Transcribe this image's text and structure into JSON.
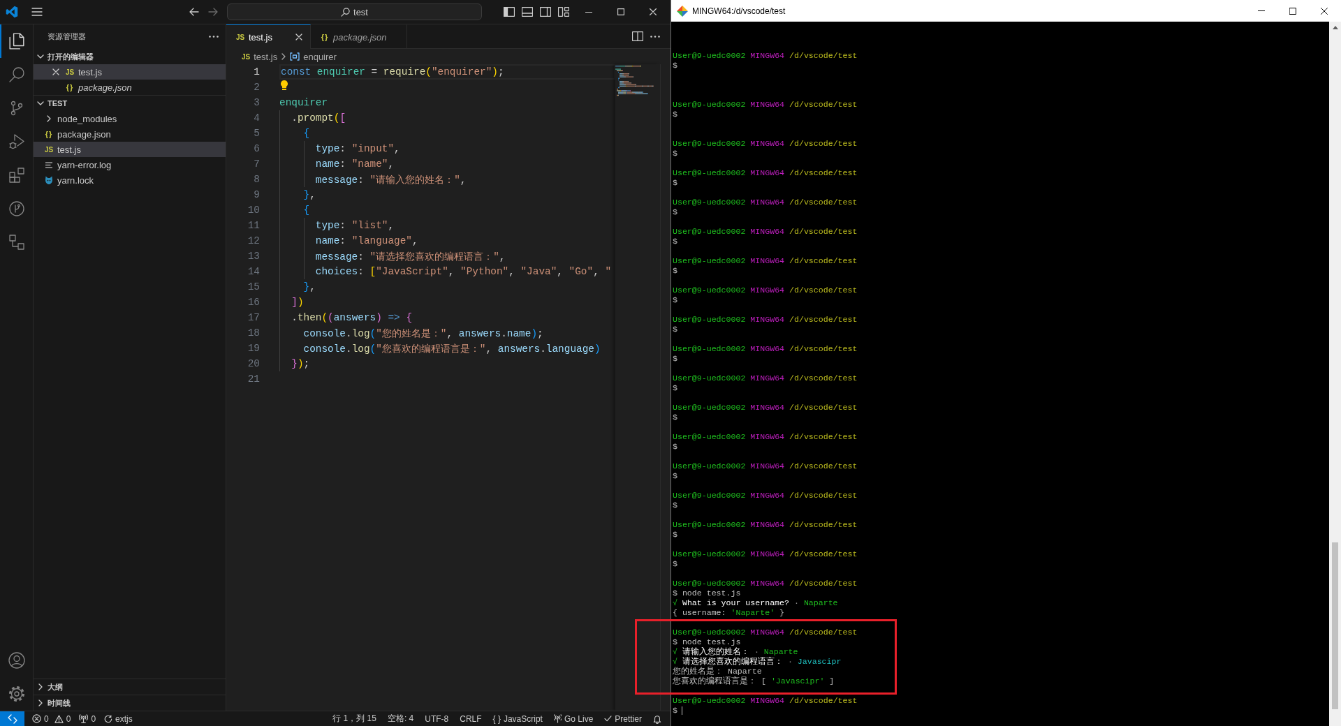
{
  "vscode": {
    "title_bar": {
      "search_text": "test"
    },
    "activity_bar": {
      "top": [
        {
          "kind": "explorer",
          "selected": true
        },
        {
          "kind": "search",
          "selected": false
        },
        {
          "kind": "scm",
          "selected": false
        },
        {
          "kind": "debug",
          "selected": false
        },
        {
          "kind": "extensions",
          "selected": false
        },
        {
          "kind": "graph",
          "selected": false
        },
        {
          "kind": "remote",
          "selected": false
        }
      ],
      "bottom": [
        {
          "kind": "account"
        },
        {
          "kind": "settings"
        }
      ]
    },
    "sidebar": {
      "title": "资源管理器",
      "sections": [
        {
          "kind": "editors",
          "title": "打开的编辑器",
          "expanded": true,
          "items": [
            {
              "kind": "js",
              "glyph": "JS",
              "label": "test.js",
              "selected": true,
              "preview": false
            },
            {
              "kind": "json",
              "glyph": "{}",
              "label": "package.json",
              "selected": false,
              "preview": true
            }
          ]
        },
        {
          "kind": "tree",
          "title": "TEST",
          "expanded": true,
          "items": [
            {
              "kind": "folder",
              "label": "node_modules",
              "expanded": false,
              "selected": false
            },
            {
              "kind": "json",
              "glyph": "{}",
              "label": "package.json",
              "selected": false
            },
            {
              "kind": "js",
              "glyph": "JS",
              "label": "test.js",
              "selected": true
            },
            {
              "kind": "log",
              "label": "yarn-error.log",
              "selected": false
            },
            {
              "kind": "yarn",
              "label": "yarn.lock",
              "selected": false
            }
          ]
        },
        {
          "kind": "pane",
          "title": "大纲",
          "expanded": false
        },
        {
          "kind": "pane",
          "title": "时间线",
          "expanded": false
        }
      ]
    },
    "editor": {
      "tabs": [
        {
          "kind": "js",
          "glyph": "JS",
          "label": "test.js",
          "selected": true,
          "preview": false
        },
        {
          "kind": "json",
          "glyph": "{}",
          "label": "package.json",
          "selected": false,
          "preview": true
        }
      ],
      "breadcrumb": [
        {
          "kind": "file",
          "glyph": "JS",
          "label": "test.js"
        },
        {
          "kind": "symbol",
          "label": "enquirer"
        }
      ],
      "lines": [
        {
          "number": "1",
          "kind": "code",
          "current": true,
          "tokens": [
            {
              "kind": "keyword",
              "text": "const "
            },
            {
              "kind": "module",
              "text": "enquirer"
            },
            {
              "kind": "plain",
              "text": " = "
            },
            {
              "kind": "function",
              "text": "require"
            },
            {
              "kind": "bracket1",
              "text": "("
            },
            {
              "kind": "string",
              "text": "\"enquirer\""
            },
            {
              "kind": "bracket1",
              "text": ")"
            },
            {
              "kind": "plain",
              "text": ";"
            }
          ]
        },
        {
          "number": "2",
          "kind": "lightbulb",
          "current": false
        },
        {
          "number": "3",
          "kind": "code",
          "current": false,
          "tokens": [
            {
              "kind": "module",
              "text": "enquirer"
            }
          ],
          "children": [
            {
              "number": "4",
              "kind": "code",
              "current": false,
              "tokens": [
                {
                  "kind": "plain",
                  "text": "."
                },
                {
                  "kind": "function",
                  "text": "prompt"
                },
                {
                  "kind": "bracket1",
                  "text": "("
                },
                {
                  "kind": "bracket2",
                  "text": "["
                }
              ],
              "children": [
                {
                  "number": "5",
                  "kind": "code",
                  "current": false,
                  "tokens": [
                    {
                      "kind": "bracket3",
                      "text": "{"
                    }
                  ],
                  "children": [
                    {
                      "number": "6",
                      "kind": "code",
                      "current": false,
                      "tokens": [
                        {
                          "kind": "property",
                          "text": "type"
                        },
                        {
                          "kind": "plain",
                          "text": ": "
                        },
                        {
                          "kind": "string",
                          "text": "\"input\""
                        },
                        {
                          "kind": "plain",
                          "text": ","
                        }
                      ]
                    },
                    {
                      "number": "7",
                      "kind": "code",
                      "current": false,
                      "tokens": [
                        {
                          "kind": "property",
                          "text": "name"
                        },
                        {
                          "kind": "plain",
                          "text": ": "
                        },
                        {
                          "kind": "string",
                          "text": "\"name\""
                        },
                        {
                          "kind": "plain",
                          "text": ","
                        }
                      ]
                    },
                    {
                      "number": "8",
                      "kind": "code",
                      "current": false,
                      "tokens": [
                        {
                          "kind": "property",
                          "text": "message"
                        },
                        {
                          "kind": "plain",
                          "text": ": "
                        },
                        {
                          "kind": "string",
                          "text": "\"请输入您的姓名：\""
                        },
                        {
                          "kind": "plain",
                          "text": ","
                        }
                      ]
                    }
                  ]
                },
                {
                  "number": "9",
                  "kind": "code",
                  "current": false,
                  "tokens": [
                    {
                      "kind": "bracket3",
                      "text": "}"
                    },
                    {
                      "kind": "plain",
                      "text": ","
                    }
                  ]
                },
                {
                  "number": "10",
                  "kind": "code",
                  "current": false,
                  "tokens": [
                    {
                      "kind": "bracket3",
                      "text": "{"
                    }
                  ],
                  "children": [
                    {
                      "number": "11",
                      "kind": "code",
                      "current": false,
                      "tokens": [
                        {
                          "kind": "property",
                          "text": "type"
                        },
                        {
                          "kind": "plain",
                          "text": ": "
                        },
                        {
                          "kind": "string",
                          "text": "\"list\""
                        },
                        {
                          "kind": "plain",
                          "text": ","
                        }
                      ]
                    },
                    {
                      "number": "12",
                      "kind": "code",
                      "current": false,
                      "tokens": [
                        {
                          "kind": "property",
                          "text": "name"
                        },
                        {
                          "kind": "plain",
                          "text": ": "
                        },
                        {
                          "kind": "string",
                          "text": "\"language\""
                        },
                        {
                          "kind": "plain",
                          "text": ","
                        }
                      ]
                    },
                    {
                      "number": "13",
                      "kind": "code",
                      "current": false,
                      "tokens": [
                        {
                          "kind": "property",
                          "text": "message"
                        },
                        {
                          "kind": "plain",
                          "text": ": "
                        },
                        {
                          "kind": "string",
                          "text": "\"请选择您喜欢的编程语言：\""
                        },
                        {
                          "kind": "plain",
                          "text": ","
                        }
                      ]
                    },
                    {
                      "number": "14",
                      "kind": "code",
                      "current": false,
                      "tokens": [
                        {
                          "kind": "property",
                          "text": "choices"
                        },
                        {
                          "kind": "plain",
                          "text": ": "
                        },
                        {
                          "kind": "bracket1",
                          "text": "["
                        },
                        {
                          "kind": "string",
                          "text": "\"JavaScript\""
                        },
                        {
                          "kind": "plain",
                          "text": ", "
                        },
                        {
                          "kind": "string",
                          "text": "\"Python\""
                        },
                        {
                          "kind": "plain",
                          "text": ", "
                        },
                        {
                          "kind": "string",
                          "text": "\"Java\""
                        },
                        {
                          "kind": "plain",
                          "text": ", "
                        },
                        {
                          "kind": "string",
                          "text": "\"Go\""
                        },
                        {
                          "kind": "plain",
                          "text": ", "
                        },
                        {
                          "kind": "string",
                          "text": "\""
                        }
                      ]
                    }
                  ]
                },
                {
                  "number": "15",
                  "kind": "code",
                  "current": false,
                  "tokens": [
                    {
                      "kind": "bracket3",
                      "text": "}"
                    },
                    {
                      "kind": "plain",
                      "text": ","
                    }
                  ]
                }
              ]
            },
            {
              "number": "16",
              "kind": "code",
              "current": false,
              "tokens": [
                {
                  "kind": "bracket2",
                  "text": "]"
                },
                {
                  "kind": "bracket1",
                  "text": ")"
                }
              ]
            },
            {
              "number": "17",
              "kind": "code",
              "current": false,
              "tokens": [
                {
                  "kind": "plain",
                  "text": "."
                },
                {
                  "kind": "function",
                  "text": "then"
                },
                {
                  "kind": "bracket1",
                  "text": "("
                },
                {
                  "kind": "bracket2",
                  "text": "("
                },
                {
                  "kind": "parameter",
                  "text": "answers"
                },
                {
                  "kind": "bracket2",
                  "text": ")"
                },
                {
                  "kind": "keyword",
                  "text": " => "
                },
                {
                  "kind": "bracket2",
                  "text": "{"
                }
              ],
              "children": [
                {
                  "number": "18",
                  "kind": "code",
                  "current": false,
                  "tokens": [
                    {
                      "kind": "variable",
                      "text": "console"
                    },
                    {
                      "kind": "plain",
                      "text": "."
                    },
                    {
                      "kind": "function",
                      "text": "log"
                    },
                    {
                      "kind": "bracket3",
                      "text": "("
                    },
                    {
                      "kind": "string",
                      "text": "\"您的姓名是：\""
                    },
                    {
                      "kind": "plain",
                      "text": ", "
                    },
                    {
                      "kind": "variable",
                      "text": "answers"
                    },
                    {
                      "kind": "plain",
                      "text": "."
                    },
                    {
                      "kind": "variable",
                      "text": "name"
                    },
                    {
                      "kind": "bracket3",
                      "text": ")"
                    },
                    {
                      "kind": "plain",
                      "text": ";"
                    }
                  ]
                },
                {
                  "number": "19",
                  "kind": "code",
                  "current": false,
                  "tokens": [
                    {
                      "kind": "variable",
                      "text": "console"
                    },
                    {
                      "kind": "plain",
                      "text": "."
                    },
                    {
                      "kind": "function",
                      "text": "log"
                    },
                    {
                      "kind": "bracket3",
                      "text": "("
                    },
                    {
                      "kind": "string",
                      "text": "\"您喜欢的编程语言是：\""
                    },
                    {
                      "kind": "plain",
                      "text": ", "
                    },
                    {
                      "kind": "variable",
                      "text": "answers"
                    },
                    {
                      "kind": "plain",
                      "text": "."
                    },
                    {
                      "kind": "variable",
                      "text": "language"
                    },
                    {
                      "kind": "bracket3",
                      "text": ")"
                    }
                  ]
                }
              ]
            },
            {
              "number": "20",
              "kind": "code",
              "current": false,
              "tokens": [
                {
                  "kind": "bracket2",
                  "text": "}"
                },
                {
                  "kind": "bracket1",
                  "text": ")"
                },
                {
                  "kind": "plain",
                  "text": ";"
                }
              ]
            }
          ]
        },
        {
          "number": "21",
          "kind": "code",
          "current": false
        }
      ]
    },
    "status_bar": {
      "left": [
        {
          "kind": "remote"
        },
        {
          "kind": "problems",
          "errors": "0",
          "warnings": "0"
        },
        {
          "kind": "ports",
          "label": "0"
        },
        {
          "kind": "sync",
          "label": "extjs"
        }
      ],
      "right": [
        {
          "kind": "text",
          "label": "行 1，列 15"
        },
        {
          "kind": "text",
          "label": "空格: 4"
        },
        {
          "kind": "text",
          "label": "UTF-8"
        },
        {
          "kind": "text",
          "label": "CRLF"
        },
        {
          "kind": "language",
          "glyph": "{ }",
          "label": "JavaScript"
        },
        {
          "kind": "golive",
          "label": "Go Live"
        },
        {
          "kind": "prettier",
          "label": "Prettier"
        },
        {
          "kind": "bell"
        }
      ]
    }
  },
  "terminal": {
    "title": "MINGW64:/d/vscode/test",
    "lines": [
      {
        "kind": "blank"
      },
      {
        "kind": "blank"
      },
      {
        "kind": "blank"
      },
      {
        "kind": "prompt",
        "user": "User@9-uedc0002",
        "shell": "MINGW64",
        "path": "/d/vscode/test"
      },
      {
        "kind": "plain",
        "text": "$"
      },
      {
        "kind": "blank"
      },
      {
        "kind": "blank"
      },
      {
        "kind": "blank"
      },
      {
        "kind": "prompt",
        "user": "User@9-uedc0002",
        "shell": "MINGW64",
        "path": "/d/vscode/test"
      },
      {
        "kind": "plain",
        "text": "$"
      },
      {
        "kind": "blank"
      },
      {
        "kind": "blank"
      },
      {
        "kind": "prompt",
        "user": "User@9-uedc0002",
        "shell": "MINGW64",
        "path": "/d/vscode/test"
      },
      {
        "kind": "plain",
        "text": "$"
      },
      {
        "kind": "blank"
      },
      {
        "kind": "prompt",
        "user": "User@9-uedc0002",
        "shell": "MINGW64",
        "path": "/d/vscode/test"
      },
      {
        "kind": "plain",
        "text": "$"
      },
      {
        "kind": "blank"
      },
      {
        "kind": "prompt",
        "user": "User@9-uedc0002",
        "shell": "MINGW64",
        "path": "/d/vscode/test"
      },
      {
        "kind": "plain",
        "text": "$"
      },
      {
        "kind": "blank"
      },
      {
        "kind": "prompt",
        "user": "User@9-uedc0002",
        "shell": "MINGW64",
        "path": "/d/vscode/test"
      },
      {
        "kind": "plain",
        "text": "$"
      },
      {
        "kind": "blank"
      },
      {
        "kind": "prompt",
        "user": "User@9-uedc0002",
        "shell": "MINGW64",
        "path": "/d/vscode/test"
      },
      {
        "kind": "plain",
        "text": "$"
      },
      {
        "kind": "blank"
      },
      {
        "kind": "prompt",
        "user": "User@9-uedc0002",
        "shell": "MINGW64",
        "path": "/d/vscode/test"
      },
      {
        "kind": "plain",
        "text": "$"
      },
      {
        "kind": "blank"
      },
      {
        "kind": "prompt",
        "user": "User@9-uedc0002",
        "shell": "MINGW64",
        "path": "/d/vscode/test"
      },
      {
        "kind": "plain",
        "text": "$"
      },
      {
        "kind": "blank"
      },
      {
        "kind": "prompt",
        "user": "User@9-uedc0002",
        "shell": "MINGW64",
        "path": "/d/vscode/test"
      },
      {
        "kind": "plain",
        "text": "$"
      },
      {
        "kind": "blank"
      },
      {
        "kind": "prompt",
        "user": "User@9-uedc0002",
        "shell": "MINGW64",
        "path": "/d/vscode/test"
      },
      {
        "kind": "plain",
        "text": "$"
      },
      {
        "kind": "blank"
      },
      {
        "kind": "prompt",
        "user": "User@9-uedc0002",
        "shell": "MINGW64",
        "path": "/d/vscode/test"
      },
      {
        "kind": "plain",
        "text": "$"
      },
      {
        "kind": "blank"
      },
      {
        "kind": "prompt",
        "user": "User@9-uedc0002",
        "shell": "MINGW64",
        "path": "/d/vscode/test"
      },
      {
        "kind": "plain",
        "text": "$"
      },
      {
        "kind": "blank"
      },
      {
        "kind": "prompt",
        "user": "User@9-uedc0002",
        "shell": "MINGW64",
        "path": "/d/vscode/test"
      },
      {
        "kind": "plain",
        "text": "$"
      },
      {
        "kind": "blank"
      },
      {
        "kind": "prompt",
        "user": "User@9-uedc0002",
        "shell": "MINGW64",
        "path": "/d/vscode/test"
      },
      {
        "kind": "plain",
        "text": "$"
      },
      {
        "kind": "blank"
      },
      {
        "kind": "prompt",
        "user": "User@9-uedc0002",
        "shell": "MINGW64",
        "path": "/d/vscode/test"
      },
      {
        "kind": "plain",
        "text": "$"
      },
      {
        "kind": "blank"
      },
      {
        "kind": "prompt",
        "user": "User@9-uedc0002",
        "shell": "MINGW64",
        "path": "/d/vscode/test"
      },
      {
        "kind": "plain",
        "text": "$"
      },
      {
        "kind": "blank"
      },
      {
        "kind": "prompt",
        "user": "User@9-uedc0002",
        "shell": "MINGW64",
        "path": "/d/vscode/test"
      },
      {
        "kind": "plain",
        "text": "$ node test.js"
      },
      {
        "kind": "parts",
        "parts": [
          {
            "kind": "check",
            "text": "√ "
          },
          {
            "kind": "question",
            "text": "What is your username? "
          },
          {
            "kind": "dim",
            "text": "· "
          },
          {
            "kind": "answer",
            "text": "Naparte"
          }
        ]
      },
      {
        "kind": "parts",
        "parts": [
          {
            "kind": "plain",
            "text": "{ username: "
          },
          {
            "kind": "string",
            "text": "'Naparte'"
          },
          {
            "kind": "plain",
            "text": " }"
          }
        ]
      },
      {
        "kind": "blank"
      },
      {
        "kind": "prompt",
        "user": "User@9-uedc0002",
        "shell": "MINGW64",
        "path": "/d/vscode/test"
      },
      {
        "kind": "plain",
        "text": "$ node test.js"
      },
      {
        "kind": "parts",
        "parts": [
          {
            "kind": "check",
            "text": "√ "
          },
          {
            "kind": "question",
            "text": "请输入您的姓名： "
          },
          {
            "kind": "dim",
            "text": "· "
          },
          {
            "kind": "answer",
            "text": "Naparte"
          }
        ]
      },
      {
        "kind": "parts",
        "parts": [
          {
            "kind": "check",
            "text": "√ "
          },
          {
            "kind": "question",
            "text": "请选择您喜欢的编程语言： "
          },
          {
            "kind": "dim",
            "text": "· "
          },
          {
            "kind": "choice",
            "text": "Javascipr"
          }
        ]
      },
      {
        "kind": "parts",
        "parts": [
          {
            "kind": "plain",
            "text": "您的姓名是： Naparte"
          }
        ]
      },
      {
        "kind": "parts",
        "parts": [
          {
            "kind": "plain",
            "text": "您喜欢的编程语言是： [ "
          },
          {
            "kind": "string",
            "text": "'Javascipr'"
          },
          {
            "kind": "plain",
            "text": " ]"
          }
        ]
      },
      {
        "kind": "blank"
      },
      {
        "kind": "prompt",
        "user": "User@9-uedc0002",
        "shell": "MINGW64",
        "path": "/d/vscode/test"
      },
      {
        "kind": "input",
        "text": "$"
      }
    ]
  }
}
